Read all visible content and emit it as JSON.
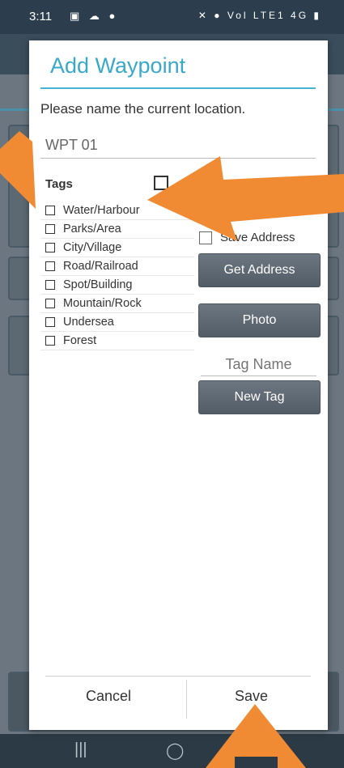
{
  "status_bar": {
    "time": "3:11",
    "right_text": "Vol LTE1 4G"
  },
  "dialog": {
    "title": "Add Waypoint",
    "prompt": "Please name the current location.",
    "name_value": "WPT 01",
    "tags_label": "Tags",
    "tags": [
      "Water/Harbour",
      "Parks/Area",
      "City/Village",
      "Road/Railroad",
      "Spot/Building",
      "Mountain/Rock",
      "Undersea",
      "Forest"
    ],
    "save_address_label": "Save Address",
    "get_address_label": "Get Address",
    "photo_label": "Photo",
    "tag_name_placeholder": "Tag Name",
    "new_tag_label": "New Tag",
    "cancel_label": "Cancel",
    "save_label": "Save"
  },
  "colors": {
    "accent": "#3aa9c9",
    "arrow": "#f08a33",
    "button": "#5d6771"
  }
}
